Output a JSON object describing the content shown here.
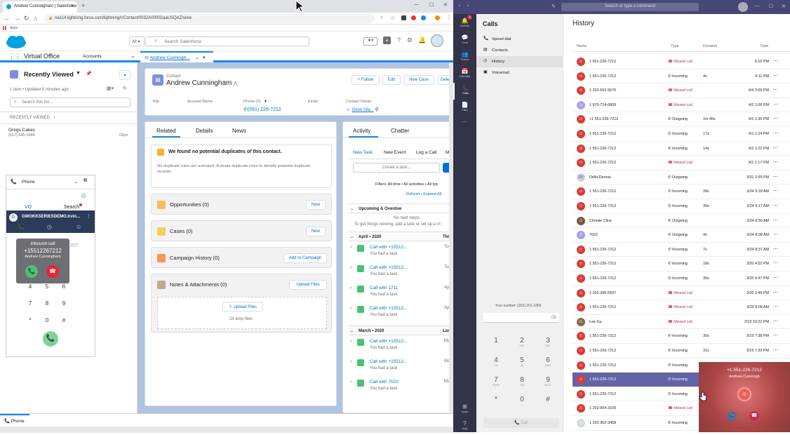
{
  "browser": {
    "tab_title": "Andrew Cunningham | Salesforce",
    "tab_new": "+",
    "url": "na114.lightning.force.com/lightning/r/Contact/0032A00002aaUSQAZ/view",
    "apps_label": "Apps",
    "win_min": "—",
    "win_max": "☐",
    "win_close": "✕"
  },
  "sf": {
    "search_scope": "All",
    "search_placeholder": "Search Salesforce",
    "app_name": "Virtual Office",
    "nav_accounts": "Accounts",
    "nav_record_tab": "Andrew Cunningh...",
    "list": {
      "title": "Recently Viewed",
      "subtitle": "1 item • Updated 5 minutes ago",
      "search_placeholder": "Search this list...",
      "section": "RECENTLY VIEWED",
      "item_name": "Gregs Cakes",
      "item_phone": "(617) 645-1984",
      "item_owner": "Oilyn"
    },
    "phone": {
      "title": "Phone",
      "tab_vo": "VO",
      "tab_search": "Search",
      "account": "GWOKKSERIESDEMO.lrvin...",
      "bg_text": "mber",
      "popup_title": "Inbound call",
      "popup_number": "+15512267212",
      "popup_name": "Andrew Cunningham",
      "keys": [
        [
          "4",
          "5",
          "6"
        ],
        [
          "7",
          "8",
          "9"
        ],
        [
          "*",
          "0",
          "#"
        ]
      ],
      "dock_label": "Phone"
    },
    "contact": {
      "label": "Contact",
      "name": "Andrew Cunningham",
      "follow": "+ Follow",
      "edit": "Edit",
      "new_case": "New Case",
      "delete": "Delet",
      "f_title": "Title",
      "f_account": "Account Name",
      "f_phone": "Phone (2)",
      "phone": "(551) 226-7212",
      "f_email": "Email",
      "f_owner": "Contact Owner",
      "owner": "Oisin Gly..."
    },
    "related": {
      "tab_related": "Related",
      "tab_details": "Details",
      "tab_news": "News",
      "dup_title": "We found no potential duplicates of this contact.",
      "dup_body": "No duplicate rules are activated. Activate duplicate rules to identify potential duplicate records.",
      "opps": "Opportunities (0)",
      "cases": "Cases (0)",
      "campaign": "Campaign History (0)",
      "notes": "Notes & Attachments (0)",
      "new": "New",
      "add_campaign": "Add to Campaign",
      "upload_files": "Upload Files",
      "upload_btn": "Upload Files",
      "drop": "Or drop files"
    },
    "activity": {
      "tab_activity": "Activity",
      "tab_chatter": "Chatter",
      "new_task": "New Task",
      "new_event": "New Event",
      "log_call": "Log a Call",
      "m": "M",
      "create_task": "Create a task...",
      "filters": "Filters: All time • All activities • All typ",
      "refresh": "Refresh • Expand All",
      "upcoming": "Upcoming & Overdue",
      "no_steps": "No next steps.",
      "get_moving": "To get things moving, add a task or set up a m",
      "april": "April • 2020",
      "april_right": "This",
      "march": "March • 2020",
      "march_right": "Last",
      "items": [
        {
          "title": "Call with +15512...",
          "sub": "You had a task",
          "date": "Tod"
        },
        {
          "title": "Call with +15512...",
          "sub": "You had a task",
          "date": "Tod"
        },
        {
          "title": "Call with 1711",
          "sub": "You had a task",
          "date": "Ap"
        },
        {
          "title": "Call with +15512...",
          "sub": "You had a task",
          "date": "Ap"
        },
        {
          "title": "Call with +15512...",
          "sub": "You had a task",
          "date": "Mar"
        },
        {
          "title": "Call with +15512...",
          "sub": "You had a task",
          "date": "Mar"
        },
        {
          "title": "Call with 7022",
          "sub": "You had a task",
          "date": "Mar"
        }
      ]
    }
  },
  "teams": {
    "search_placeholder": "Search or type a command",
    "rail": [
      "Activity",
      "Chat",
      "Teams",
      "Calendar",
      "Calls",
      "Files",
      "...",
      "Apps",
      "Help"
    ],
    "rail_badge": "2",
    "calls_title": "Calls",
    "nav": [
      "Speed dial",
      "Contacts",
      "History",
      "Voicemail"
    ],
    "your_number": "Your number: (202) 201-1866",
    "dial_keys": [
      [
        "1",
        ""
      ],
      [
        "2",
        "ABC"
      ],
      [
        "3",
        "DEF"
      ],
      [
        "4",
        "GHI"
      ],
      [
        "5",
        "JKL"
      ],
      [
        "6",
        "MNO"
      ],
      [
        "7",
        "PQRS"
      ],
      [
        "8",
        "TUV"
      ],
      [
        "9",
        "WXYZ"
      ],
      [
        "*",
        ""
      ],
      [
        "0",
        "+"
      ],
      [
        "#",
        ""
      ]
    ],
    "call_btn": "Call",
    "history_title": "History",
    "cols": [
      "Name",
      "Type",
      "Duration",
      "Date"
    ],
    "rows": [
      {
        "name": "1 551-226-7212",
        "type": "Missed call",
        "dur": "",
        "date": "6:15 PM",
        "c": "#d93b3b"
      },
      {
        "name": "1 551-226-7212",
        "type": "Incoming",
        "dur": "4s",
        "date": "6:11 PM",
        "c": "#d93b3b"
      },
      {
        "name": "1 202-552-5570",
        "type": "Missed call",
        "dur": "",
        "date": "4/4 3:09 PM",
        "c": "#d93b3b"
      },
      {
        "name": "1 970-714-6809",
        "type": "Missed call",
        "dur": "",
        "date": "4/2 1:06 PM",
        "c": "#a9a3de"
      },
      {
        "name": "+1 551-226-7212",
        "type": "Outgoing",
        "dur": "1m 45s",
        "date": "4/1 1:35 PM",
        "c": "#d93b3b"
      },
      {
        "name": "1 551-226-7212",
        "type": "Incoming",
        "dur": "17s",
        "date": "4/1 1:24 PM",
        "c": "#d93b3b"
      },
      {
        "name": "1 551-226-7212",
        "type": "Incoming",
        "dur": "14s",
        "date": "4/1 1:22 PM",
        "c": "#d93b3b"
      },
      {
        "name": "1 551-226-7212",
        "type": "Missed call",
        "dur": "",
        "date": "4/1 1:17 PM",
        "c": "#d93b3b"
      },
      {
        "name": "Della Dennis",
        "type": "Outgoing",
        "dur": "",
        "date": "3/31 2:55 PM",
        "c": "#cfd0ea",
        "initials": "DD"
      },
      {
        "name": "1 551-226-7212",
        "type": "Incoming",
        "dur": "28s",
        "date": "3/24 9:18 AM",
        "c": "#d93b3b"
      },
      {
        "name": "1 551-226-7212",
        "type": "Incoming",
        "dur": "39s",
        "date": "3/24 9:17 AM",
        "c": "#d93b3b"
      },
      {
        "name": "Christie Cline",
        "type": "Outgoing",
        "dur": "",
        "date": "3/24 8:50 AM",
        "c": "#7a5a45"
      },
      {
        "name": "7022",
        "type": "Outgoing",
        "dur": "4s",
        "date": "3/24 8:38 AM",
        "c": "#a9a3de"
      },
      {
        "name": "1 551-226-7212",
        "type": "Incoming",
        "dur": "7s",
        "date": "3/24 8:37 AM",
        "c": "#d93b3b"
      },
      {
        "name": "1 551-226-7212",
        "type": "Incoming",
        "dur": "18s",
        "date": "3/20 4:52 PM",
        "c": "#d93b3b"
      },
      {
        "name": "1 551-226-7212",
        "type": "Incoming",
        "dur": "35s",
        "date": "3/20 4:47 PM",
        "c": "#d93b3b"
      },
      {
        "name": "1 202-390-5597",
        "type": "Missed call",
        "dur": "",
        "date": "3/20 2:49 PM",
        "c": "#d93b3b"
      },
      {
        "name": "1 551-226-7212",
        "type": "Missed call",
        "dur": "",
        "date": "3/20 9:08 AM",
        "c": "#d93b3b"
      },
      {
        "name": "Lee Gu",
        "type": "Missed call",
        "dur": "",
        "date": "2/19 10:22 PM",
        "c": "#8a6a50"
      },
      {
        "name": "1 551-226-7212",
        "type": "Incoming",
        "dur": "30s",
        "date": "3/19 7:38 PM",
        "c": "#d93b3b"
      },
      {
        "name": "1 551-226-7212",
        "type": "Incoming",
        "dur": "31s",
        "date": "3/19 7:33 PM",
        "c": "#d93b3b"
      },
      {
        "name": "1 551-226-7212",
        "type": "Incoming",
        "dur": "",
        "date": "",
        "c": "#d93b3b"
      },
      {
        "name": "1 551-226-7212",
        "type": "Incoming",
        "dur": "",
        "date": "",
        "c": "#d93b3b",
        "selected": true
      },
      {
        "name": "1 551-226-7212",
        "type": "Incoming",
        "dur": "",
        "date": "",
        "c": "#d93b3b"
      },
      {
        "name": "1 202-904-3109",
        "type": "Missed call",
        "dur": "",
        "date": "",
        "c": "#d93b3b"
      },
      {
        "name": "1 202-302-3458",
        "type": "Incoming",
        "dur": "",
        "date": "",
        "c": "#d5dbd5"
      }
    ],
    "toast_number": "+1 551-226-7212",
    "toast_name": "Andrew Cunningh"
  }
}
